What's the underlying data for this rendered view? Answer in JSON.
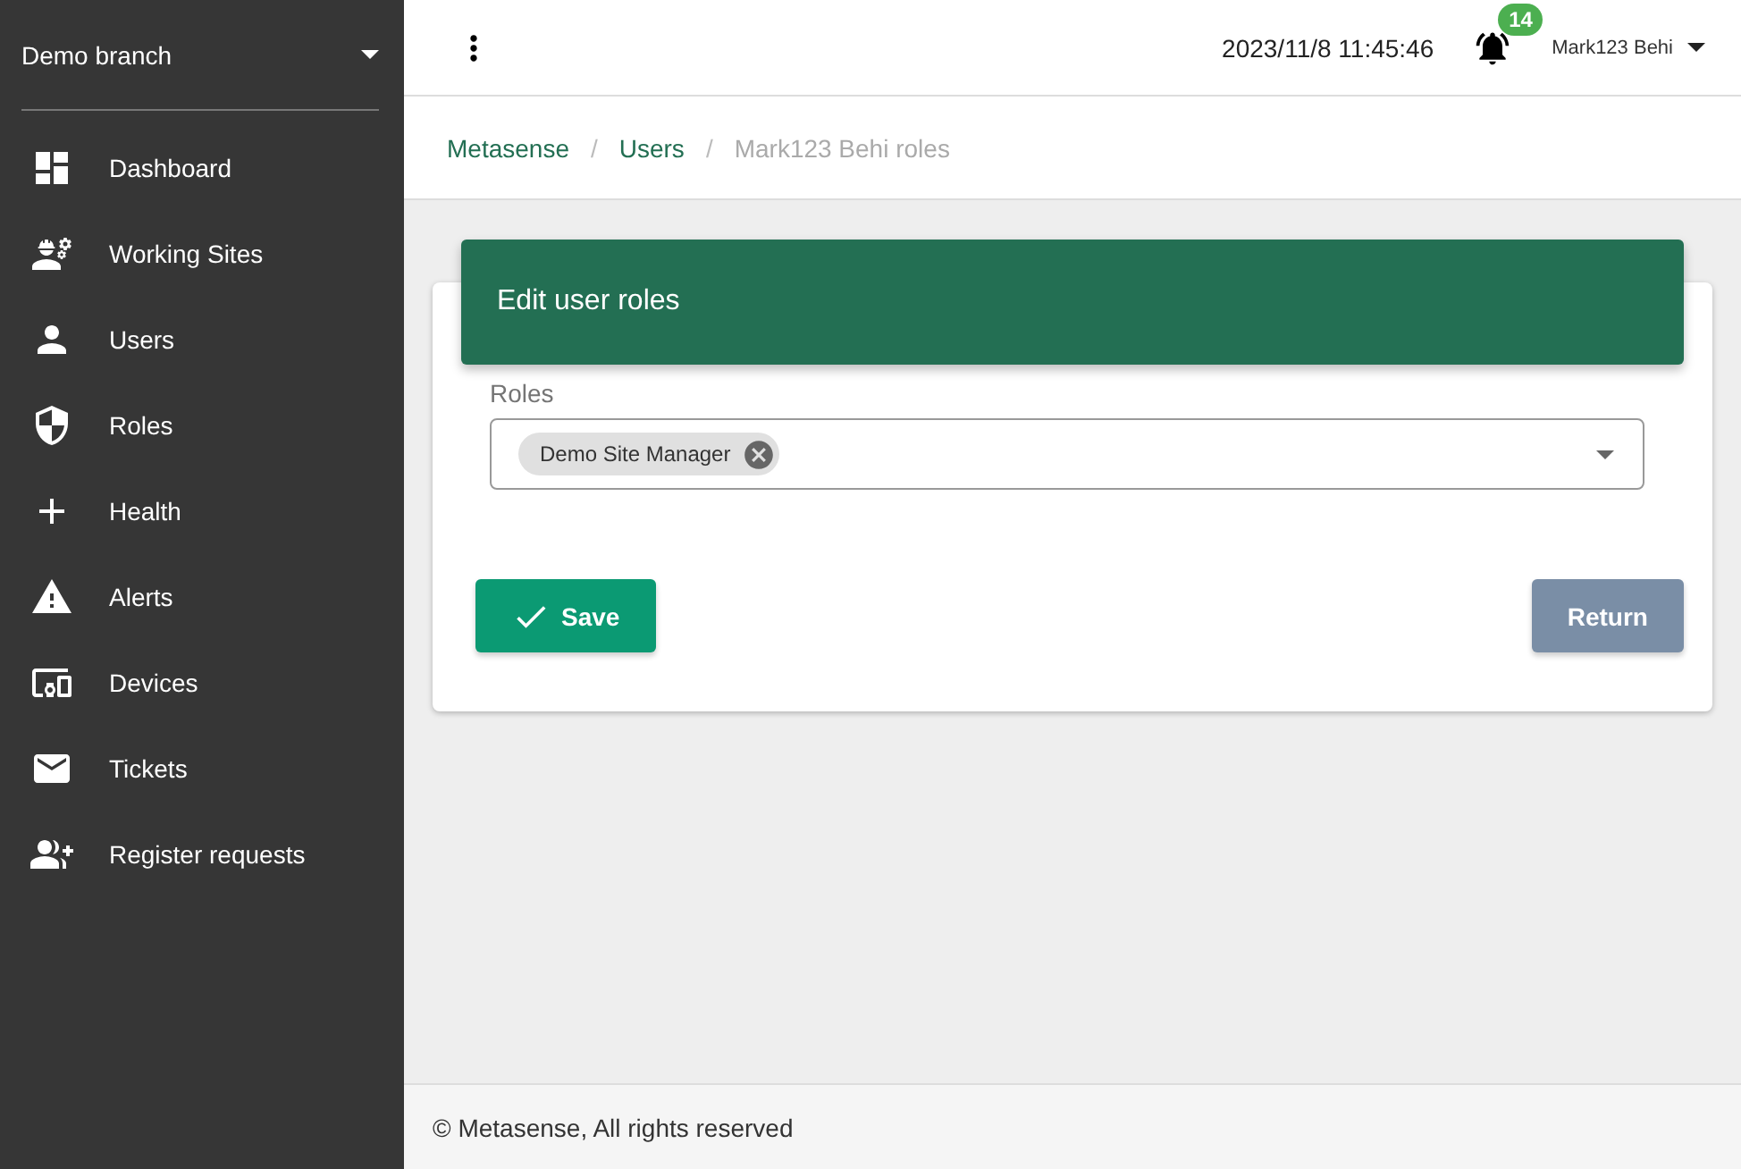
{
  "sidebar": {
    "branch": "Demo branch",
    "items": [
      {
        "label": "Dashboard",
        "kind": "dashboard"
      },
      {
        "label": "Working Sites",
        "kind": "sites"
      },
      {
        "label": "Users",
        "kind": "users"
      },
      {
        "label": "Roles",
        "kind": "roles"
      },
      {
        "label": "Health",
        "kind": "health"
      },
      {
        "label": "Alerts",
        "kind": "alerts"
      },
      {
        "label": "Devices",
        "kind": "devices"
      },
      {
        "label": "Tickets",
        "kind": "tickets"
      },
      {
        "label": "Register requests",
        "kind": "requests"
      }
    ]
  },
  "topbar": {
    "datetime": "2023/11/8 11:45:46",
    "notifications": "14",
    "user": "Mark123 Behi"
  },
  "breadcrumbs": [
    {
      "label": "Metasense",
      "current": false
    },
    {
      "label": "Users",
      "current": false
    },
    {
      "label": "Mark123 Behi roles",
      "current": true
    }
  ],
  "breadcrumb_separator": "/",
  "card": {
    "title": "Edit user roles",
    "field": {
      "label": "Roles",
      "chips": [
        "Demo Site Manager"
      ]
    },
    "save": "Save",
    "return": "Return"
  },
  "footer": "© Metasense, All rights reserved"
}
